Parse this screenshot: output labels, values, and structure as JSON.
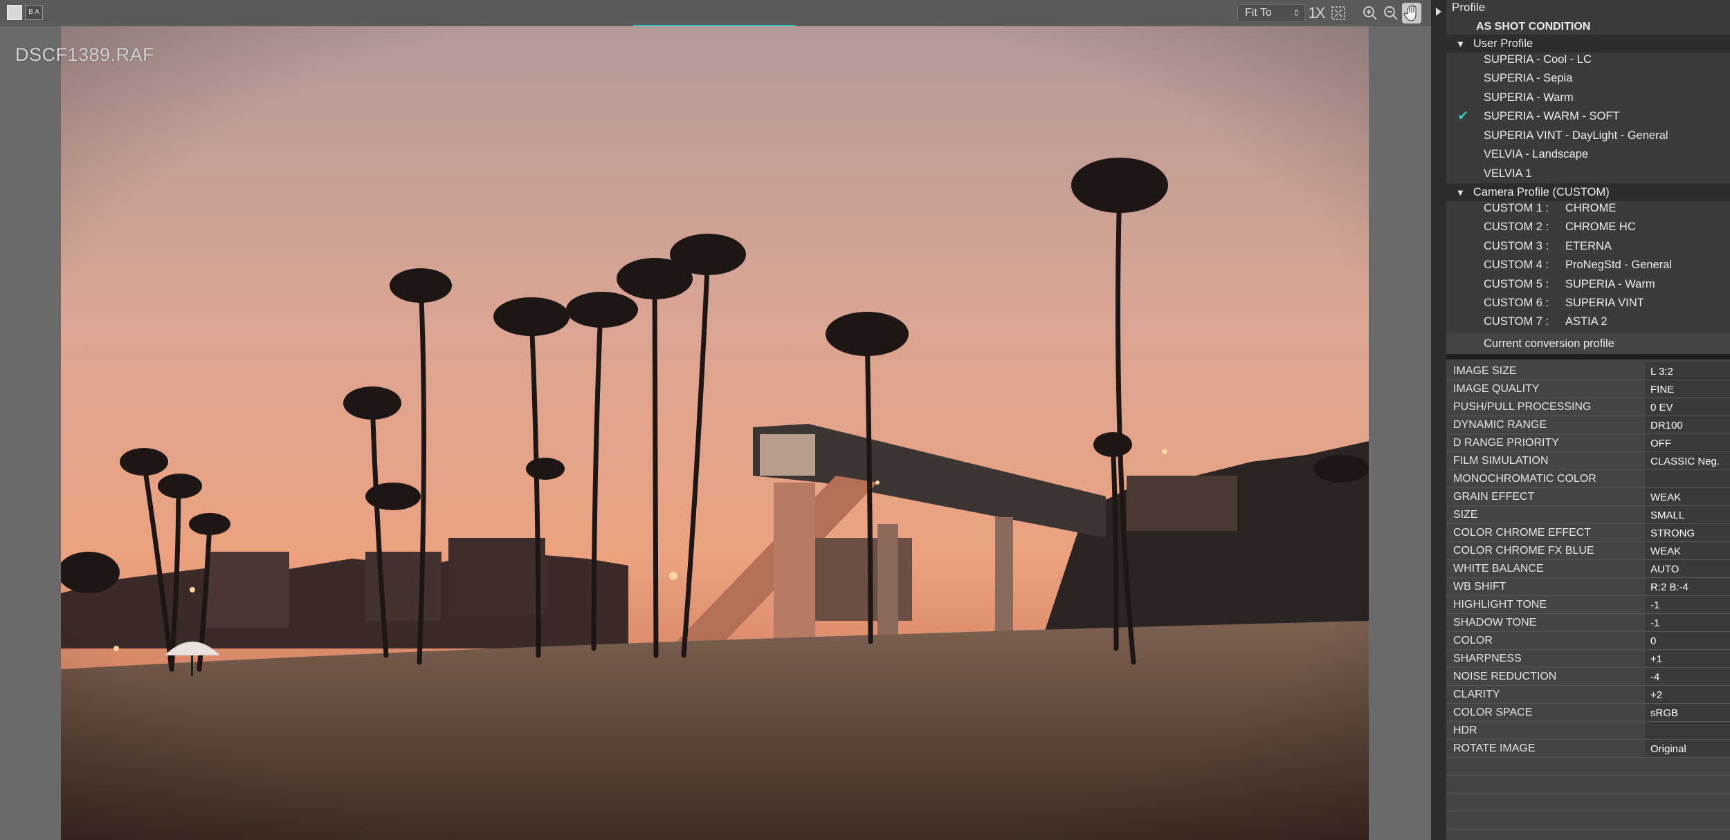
{
  "viewer": {
    "filename": "DSCF1389.RAF",
    "zoom_select": "Fit To",
    "toolbar_ba_label": "B A",
    "tool_1x_label": "1X"
  },
  "profile_panel": {
    "header": "Profile",
    "as_shot": "AS SHOT CONDITION",
    "user_group": "User Profile",
    "user_profiles": [
      "SUPERIA - Cool - LC",
      "SUPERIA - Sepia",
      "SUPERIA - Warm",
      "SUPERIA - WARM - SOFT",
      "SUPERIA VINT - DayLight - General",
      "VELVIA - Landscape",
      "VELVIA 1"
    ],
    "selected_index": 3,
    "camera_group": "Camera Profile (CUSTOM)",
    "custom_profiles": [
      {
        "slot": "CUSTOM 1 :",
        "name": "CHROME"
      },
      {
        "slot": "CUSTOM 2 :",
        "name": "CHROME HC"
      },
      {
        "slot": "CUSTOM 3 :",
        "name": "ETERNA"
      },
      {
        "slot": "CUSTOM 4 :",
        "name": "ProNegStd - General"
      },
      {
        "slot": "CUSTOM 5 :",
        "name": "SUPERIA - Warm"
      },
      {
        "slot": "CUSTOM 6 :",
        "name": "SUPERIA VINT"
      },
      {
        "slot": "CUSTOM 7 :",
        "name": "ASTIA 2"
      }
    ],
    "current_conversion": "Current conversion profile"
  },
  "settings": [
    {
      "label": "IMAGE SIZE",
      "value": "L 3:2"
    },
    {
      "label": "IMAGE QUALITY",
      "value": "FINE"
    },
    {
      "label": "PUSH/PULL PROCESSING",
      "value": "0 EV"
    },
    {
      "label": "DYNAMIC RANGE",
      "value": "DR100"
    },
    {
      "label": "D RANGE PRIORITY",
      "value": "OFF"
    },
    {
      "label": "FILM SIMULATION",
      "value": "CLASSIC Neg."
    },
    {
      "label": "MONOCHROMATIC COLOR",
      "value": ""
    },
    {
      "label": "GRAIN EFFECT",
      "value": "WEAK"
    },
    {
      "label": "SIZE",
      "value": "SMALL"
    },
    {
      "label": "COLOR CHROME EFFECT",
      "value": "STRONG"
    },
    {
      "label": "COLOR CHROME FX BLUE",
      "value": "WEAK"
    },
    {
      "label": "WHITE BALANCE",
      "value": "AUTO"
    },
    {
      "label": "WB SHIFT",
      "value": "R:2 B:-4"
    },
    {
      "label": "HIGHLIGHT TONE",
      "value": "-1"
    },
    {
      "label": "SHADOW TONE",
      "value": "-1"
    },
    {
      "label": "COLOR",
      "value": "0"
    },
    {
      "label": "SHARPNESS",
      "value": "+1"
    },
    {
      "label": "NOISE REDUCTION",
      "value": "-4"
    },
    {
      "label": "CLARITY",
      "value": "+2"
    },
    {
      "label": "COLOR SPACE",
      "value": "sRGB"
    },
    {
      "label": "HDR",
      "value": ""
    },
    {
      "label": "ROTATE IMAGE",
      "value": "Original"
    }
  ],
  "colors": {
    "accent": "#2ec6b0",
    "sky_top": "#b59a96",
    "sky_bottom": "#e89a78",
    "sand": "#6a5345"
  },
  "icons": {
    "single_view": "single-view-icon",
    "before_after": "before-after-icon",
    "actual_size": "actual-size-icon",
    "fit_window": "fit-window-icon",
    "zoom_in": "zoom-in-icon",
    "zoom_out": "zoom-out-icon",
    "hand": "hand-tool-icon",
    "check": "checkmark-icon",
    "collapse": "triangle-down-icon"
  }
}
